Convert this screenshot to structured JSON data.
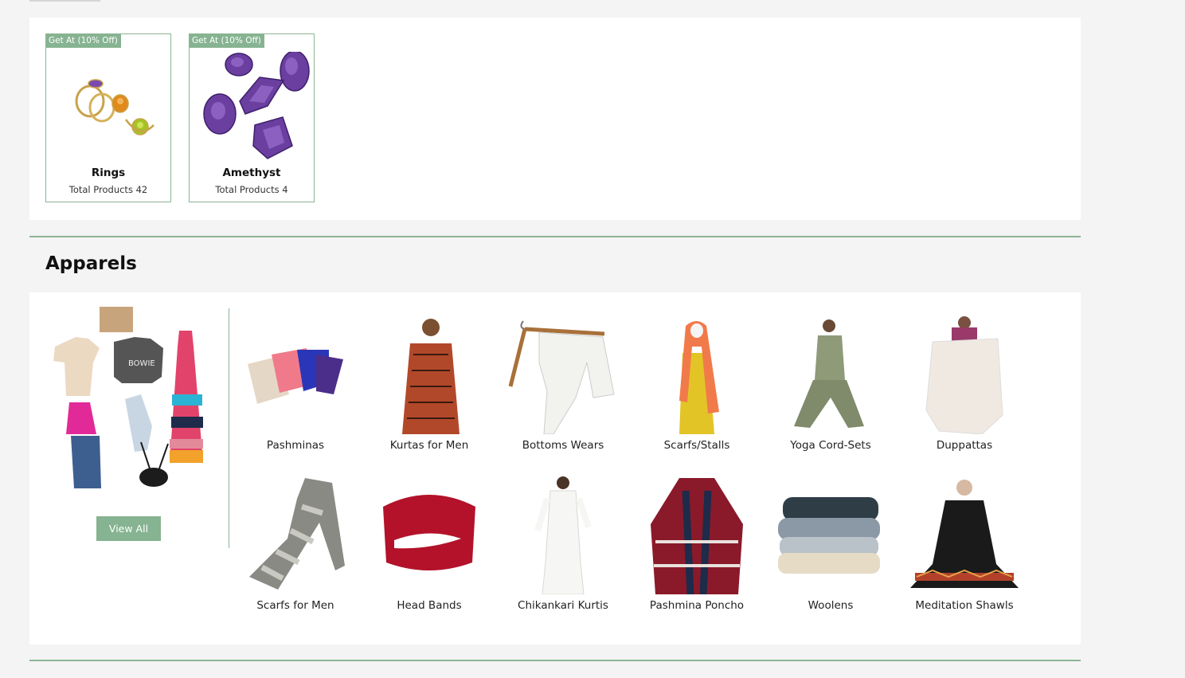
{
  "jewellery": {
    "cards": [
      {
        "badge": "Get At (10% Off)",
        "name": "Rings",
        "count": "Total Products 42",
        "icon": "rings-image"
      },
      {
        "badge": "Get At (10% Off)",
        "name": "Amethyst",
        "count": "Total Products 4",
        "icon": "amethyst-gems-image"
      }
    ]
  },
  "apparels": {
    "title": "Apparels",
    "view_all": "View All",
    "categories": [
      {
        "label": "Pashminas",
        "icon": "folded-pashminas-image"
      },
      {
        "label": "Kurtas for Men",
        "icon": "mens-kurta-image"
      },
      {
        "label": "Bottoms Wears",
        "icon": "white-trousers-on-hanger-image"
      },
      {
        "label": "Scarfs/Stalls",
        "icon": "scarf-on-mannequin-image"
      },
      {
        "label": "Yoga Cord-Sets",
        "icon": "yoga-cord-set-image"
      },
      {
        "label": "Duppattas",
        "icon": "white-dupatta-image"
      },
      {
        "label": "Scarfs for Men",
        "icon": "grey-striped-scarf-image"
      },
      {
        "label": "Head Bands",
        "icon": "red-headband-image"
      },
      {
        "label": "Chikankari Kurtis",
        "icon": "white-chikankari-kurti-image"
      },
      {
        "label": "Pashmina Poncho",
        "icon": "plaid-poncho-image"
      },
      {
        "label": "Woolens",
        "icon": "stacked-woolens-image"
      },
      {
        "label": "Meditation Shawls",
        "icon": "meditation-shawl-image"
      }
    ]
  },
  "colors": {
    "accent_green": "#86b391",
    "amethyst": "#6a3fa0",
    "crimson": "#b3122a"
  }
}
